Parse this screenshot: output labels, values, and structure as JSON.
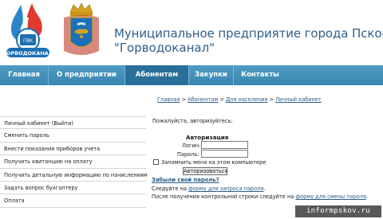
{
  "header": {
    "title_line1": "Муниципальное предприятие города Пскова",
    "title_line2": "\"Горводоканал\"",
    "logo_text": "ГОРВОДОКАНАЛ"
  },
  "nav": {
    "items": [
      {
        "label": "Главная"
      },
      {
        "label": "О предприятии"
      },
      {
        "label": "Абонентам"
      },
      {
        "label": "Закупки"
      },
      {
        "label": "Контакты"
      }
    ],
    "active": "Абонентам"
  },
  "left_menu": {
    "items": [
      {
        "label": "Личный кабинет (Выйти)"
      },
      {
        "label": "Сменить пароль"
      },
      {
        "label": "Внести показания приборов учета"
      },
      {
        "label": "Получить квитанцию на оплату"
      },
      {
        "label": "Получить детальную информацию по начислениям"
      },
      {
        "label": "Задать вопрос бухгалтеру"
      },
      {
        "label": "Оплата"
      }
    ]
  },
  "breadcrumb": {
    "items": [
      "Главная",
      "Абонентам",
      "Для населения",
      "Личный кабинет"
    ],
    "separator": " > "
  },
  "login": {
    "prompt": "Пожалуйста, авторизуйтесь:",
    "title": "Авторизация",
    "login_label": "Логин:",
    "login_value": "",
    "password_label": "Пароль:",
    "password_value": "",
    "remember_label": "Запомнить меня на этом компьютере",
    "remember_checked": false,
    "button_label": "Авторизоваться",
    "forgot_label": "Забыли свой пароль?",
    "follow1_prefix": "Следуйте на ",
    "follow1_link": "форму для запроса пароля",
    "follow1_suffix": ".",
    "follow2_prefix": "После получения контрольной строки следуйте на ",
    "follow2_link": "форму для смены пароля",
    "follow2_suffix": "."
  },
  "watermark": {
    "text": "informpskov.ru"
  },
  "colors": {
    "nav_bg": "#3a86b0",
    "nav_active": "#2a6f99",
    "title": "#2f5f8c",
    "link": "#2a5b86"
  }
}
